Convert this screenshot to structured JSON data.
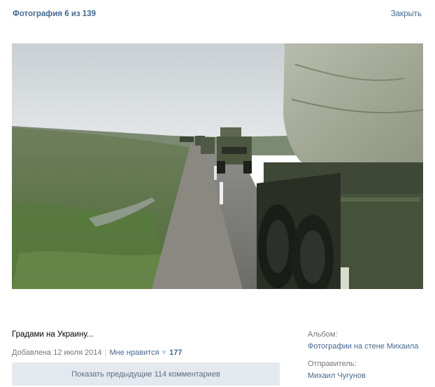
{
  "header": {
    "title": "Фотография 6 из 139",
    "close_label": "Закрыть"
  },
  "photo": {
    "description_icon": "photo-military-convoy"
  },
  "caption": "Градами на Украину...",
  "meta": {
    "added": "Добавлена 12 июля 2014",
    "separator": "|",
    "like_label": "Мне нравится",
    "heart_icon": "♥",
    "like_count": "177"
  },
  "comments": {
    "show_previous": "Показать предыдущие 114 комментариев"
  },
  "sidebar": {
    "album_label": "Альбом:",
    "album_value": "Фотографии на стене Михаила",
    "sender_label": "Отправитель:",
    "sender_value": "Михаил Чугунов"
  },
  "colors": {
    "link": "#45688e",
    "muted": "#777777",
    "button_bg": "#e4e9ef"
  }
}
